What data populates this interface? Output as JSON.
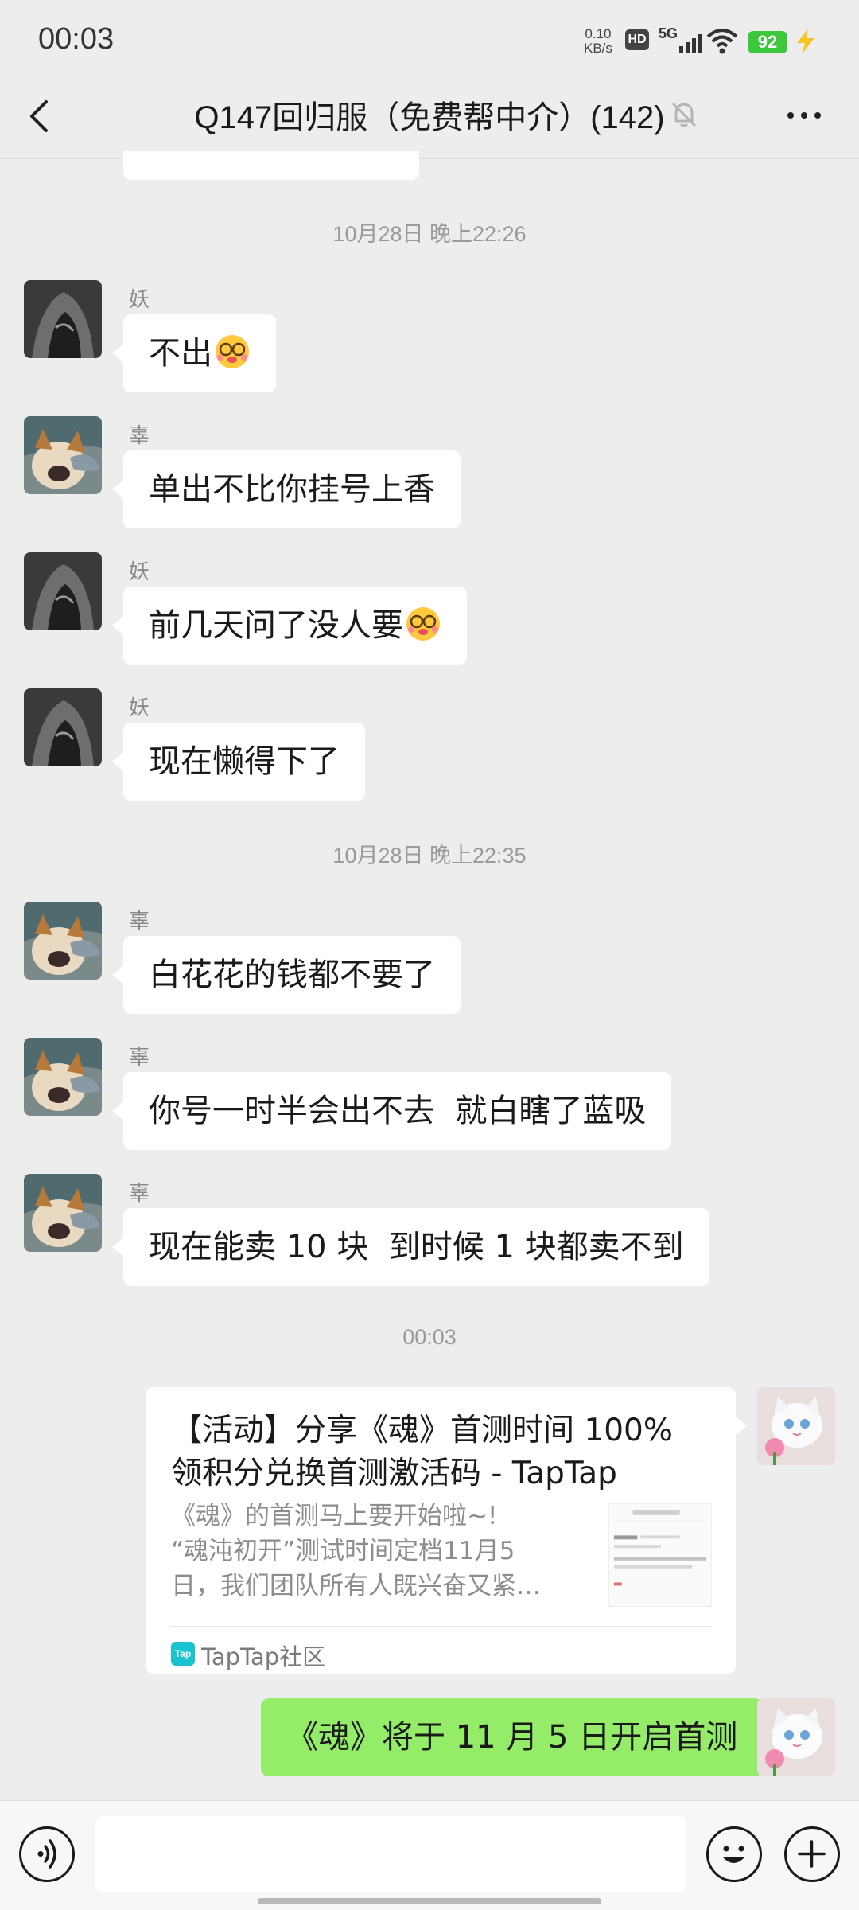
{
  "status_bar": {
    "time": "00:03",
    "net_speed_value": "0.10",
    "net_speed_unit": "KB/s",
    "hd_label": "HD",
    "network_label": "5G",
    "battery_level": "92"
  },
  "header": {
    "title": "Q147回归服（免费帮中介）(142)",
    "back_icon": "chevron-left-icon",
    "mute_icon": "bell-off-icon",
    "more_icon": "more-dots-icon"
  },
  "messages": {
    "ts1": "10月28日 晚上22:26",
    "m1": {
      "sender": "妖",
      "text": "不出"
    },
    "m2": {
      "sender": "辜",
      "text": "单出不比你挂号上香"
    },
    "m3": {
      "sender": "妖",
      "text": "前几天问了没人要"
    },
    "m4": {
      "sender": "妖",
      "text": "现在懒得下了"
    },
    "ts2": "10月28日 晚上22:35",
    "m5": {
      "sender": "辜",
      "text": "白花花的钱都不要了"
    },
    "m6": {
      "sender": "辜",
      "text": "你号一时半会出不去  就白瞎了蓝吸"
    },
    "m7": {
      "sender": "辜",
      "text": "现在能卖 10 块  到时候 1 块都卖不到"
    },
    "ts3": "00:03",
    "link_card": {
      "title_line1": "【活动】分享《魂》首测时间 100%",
      "title_line2": "领积分兑换首测激活码 - TapTap",
      "desc_line1": "《魂》的首测马上要开始啦~!",
      "desc_line2": "“魂沌初开”测试时间定档11月5",
      "desc_line3": "日，我们团队所有人既兴奋又紧…",
      "source_icon_text": "Tap",
      "source": "TapTap社区"
    },
    "m8": {
      "text": "《魂》将于 11 月 5 日开启首测"
    }
  },
  "colors": {
    "background": "#ededed",
    "bubble_left": "#ffffff",
    "bubble_right": "#95ec69",
    "battery": "#3cc83c"
  }
}
